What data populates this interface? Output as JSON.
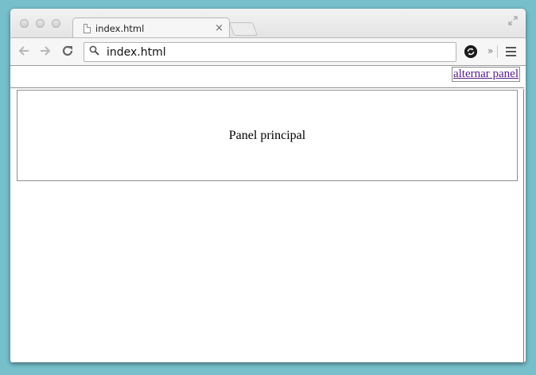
{
  "browser": {
    "tab_title": "index.html",
    "tab_close": "×",
    "address": "index.html"
  },
  "icons": {
    "back": "arrow-left-icon",
    "forward": "arrow-right-icon",
    "reload": "reload-icon",
    "search": "search-icon",
    "extension": "sync-extension-icon",
    "overflow": "chevron-double-right-icon",
    "menu": "hamburger-menu-icon",
    "fullscreen": "fullscreen-icon",
    "file": "file-icon"
  },
  "page": {
    "toggle_link": "alternar panel",
    "main_panel_text": "Panel principal"
  },
  "colors": {
    "desktop": "#77bfcb",
    "link": "#551a8b",
    "side_edge": "#c45a72"
  }
}
